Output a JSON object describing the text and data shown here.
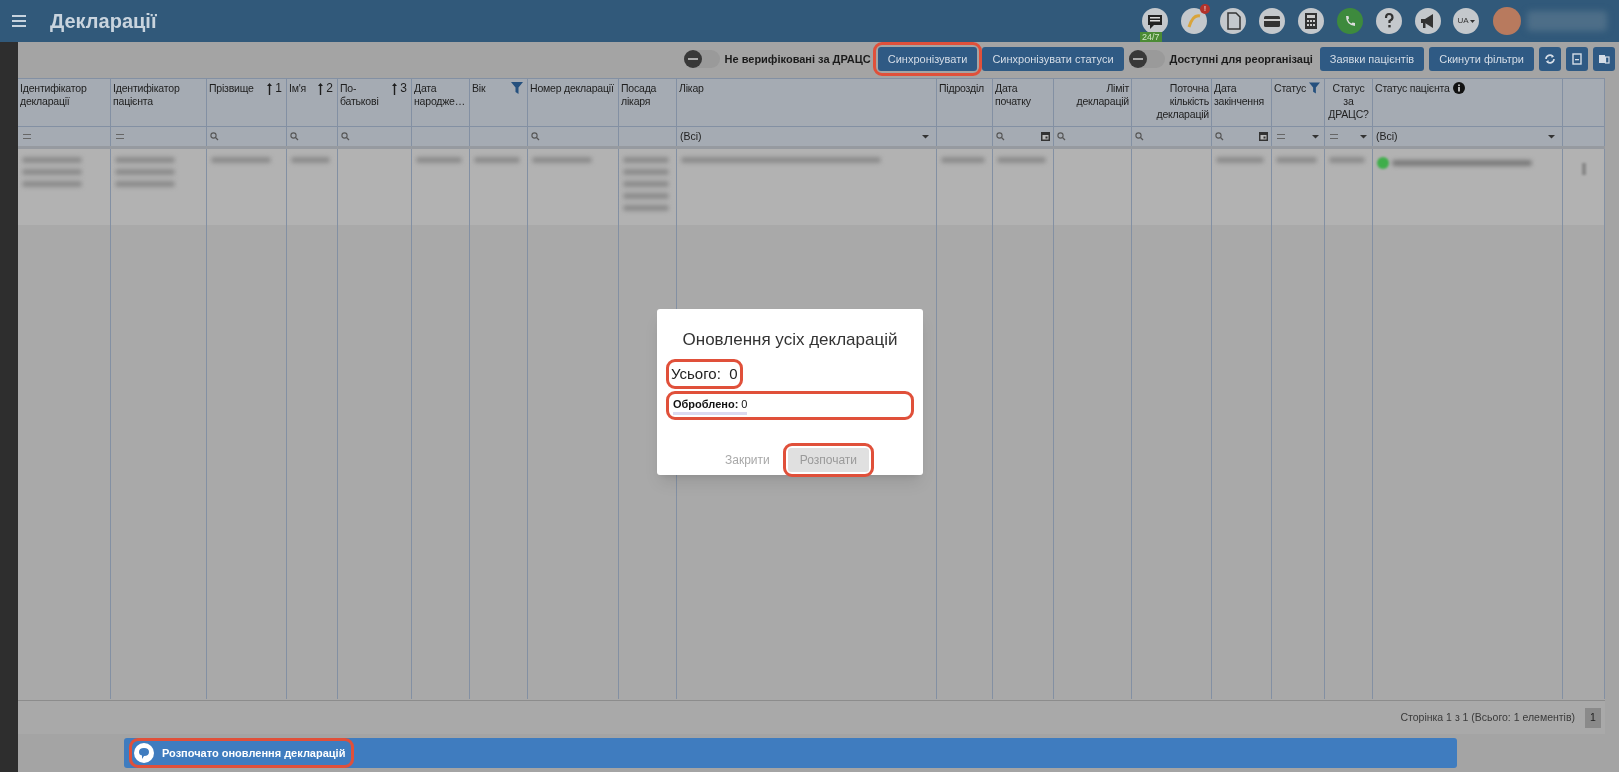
{
  "header": {
    "title": "Декларації",
    "chat_badge": "24/7",
    "alert_badge": "!",
    "language": "UA"
  },
  "toolbar": {
    "items": [
      {
        "kind": "toggle",
        "label": "Не верифіковані за ДРАЦС",
        "on": false
      },
      {
        "kind": "button",
        "label": "Синхронізувати",
        "highlighted": true
      },
      {
        "kind": "button",
        "label": "Синхронізувати статуси",
        "highlighted": false
      },
      {
        "kind": "toggle",
        "label": "Доступні для реорганізаці",
        "on": false
      },
      {
        "kind": "button",
        "label": "Заявки пацієнтів",
        "highlighted": false
      },
      {
        "kind": "button",
        "label": "Скинути фільтри",
        "highlighted": false
      },
      {
        "kind": "refresh",
        "highlighted": false
      },
      {
        "kind": "export",
        "highlighted": false
      },
      {
        "kind": "columns",
        "highlighted": false
      }
    ]
  },
  "table": {
    "columns": [
      {
        "label": "Ідентифікатор декларації",
        "filter": {
          "kind": "equals"
        }
      },
      {
        "label": "Ідентифікатор пацієнта",
        "filter": {
          "kind": "equals"
        }
      },
      {
        "label": "Прізвище",
        "sort": "1",
        "filter": {
          "kind": "search"
        }
      },
      {
        "label": "Ім'я",
        "sort": "2",
        "filter": {
          "kind": "search"
        }
      },
      {
        "label": "По-батькові",
        "sort": "3",
        "filter": {
          "kind": "search"
        }
      },
      {
        "label": "Дата народже…"
      },
      {
        "label": "Вік",
        "filter_icon": true
      },
      {
        "label": "Номер декларації",
        "filter": {
          "kind": "search"
        }
      },
      {
        "label": "Посада лікаря"
      },
      {
        "label": "Лікар",
        "filter": {
          "kind": "select",
          "value": "(Всі)"
        }
      },
      {
        "label": "Підрозділ"
      },
      {
        "label": "Дата початку",
        "filter": {
          "kind": "date"
        }
      },
      {
        "label": "Ліміт декларацій",
        "filter": {
          "kind": "search"
        }
      },
      {
        "label": "Поточна кількість декларацій",
        "filter": {
          "kind": "search"
        }
      },
      {
        "label": "Дата закінчення",
        "filter": {
          "kind": "date"
        }
      },
      {
        "label": "Статус",
        "filter_icon": true,
        "filter": {
          "kind": "dropdown"
        }
      },
      {
        "label": "Статус за ДРАЦС?",
        "filter": {
          "kind": "dropdown"
        }
      },
      {
        "label": "Статус пацієнта",
        "info_icon": true,
        "filter": {
          "kind": "select",
          "value": "(Всі)"
        }
      },
      {}
    ],
    "rows": [
      {
        "redacted": true
      }
    ]
  },
  "pager": {
    "summary": "Сторінка 1 з 1 (Всього: 1 елементів)",
    "pages": [
      {
        "label": "1",
        "selected": true
      }
    ]
  },
  "dialog": {
    "title": "Оновлення усіх декларацій",
    "total": "Усього:  0",
    "total_highlighted": true,
    "processed": "**Оброблено:** 0",
    "processed_highlighted": true,
    "level": 0,
    "buttons": [
      {
        "label": "Закрити",
        "kind": "text",
        "disabled": false,
        "highlighted": false
      },
      {
        "label": "Розпочати",
        "kind": "filled",
        "disabled": true,
        "highlighted": true
      }
    ]
  },
  "toast": {
    "message": "Розпочато оновлення декларацій",
    "highlighted": true
  }
}
